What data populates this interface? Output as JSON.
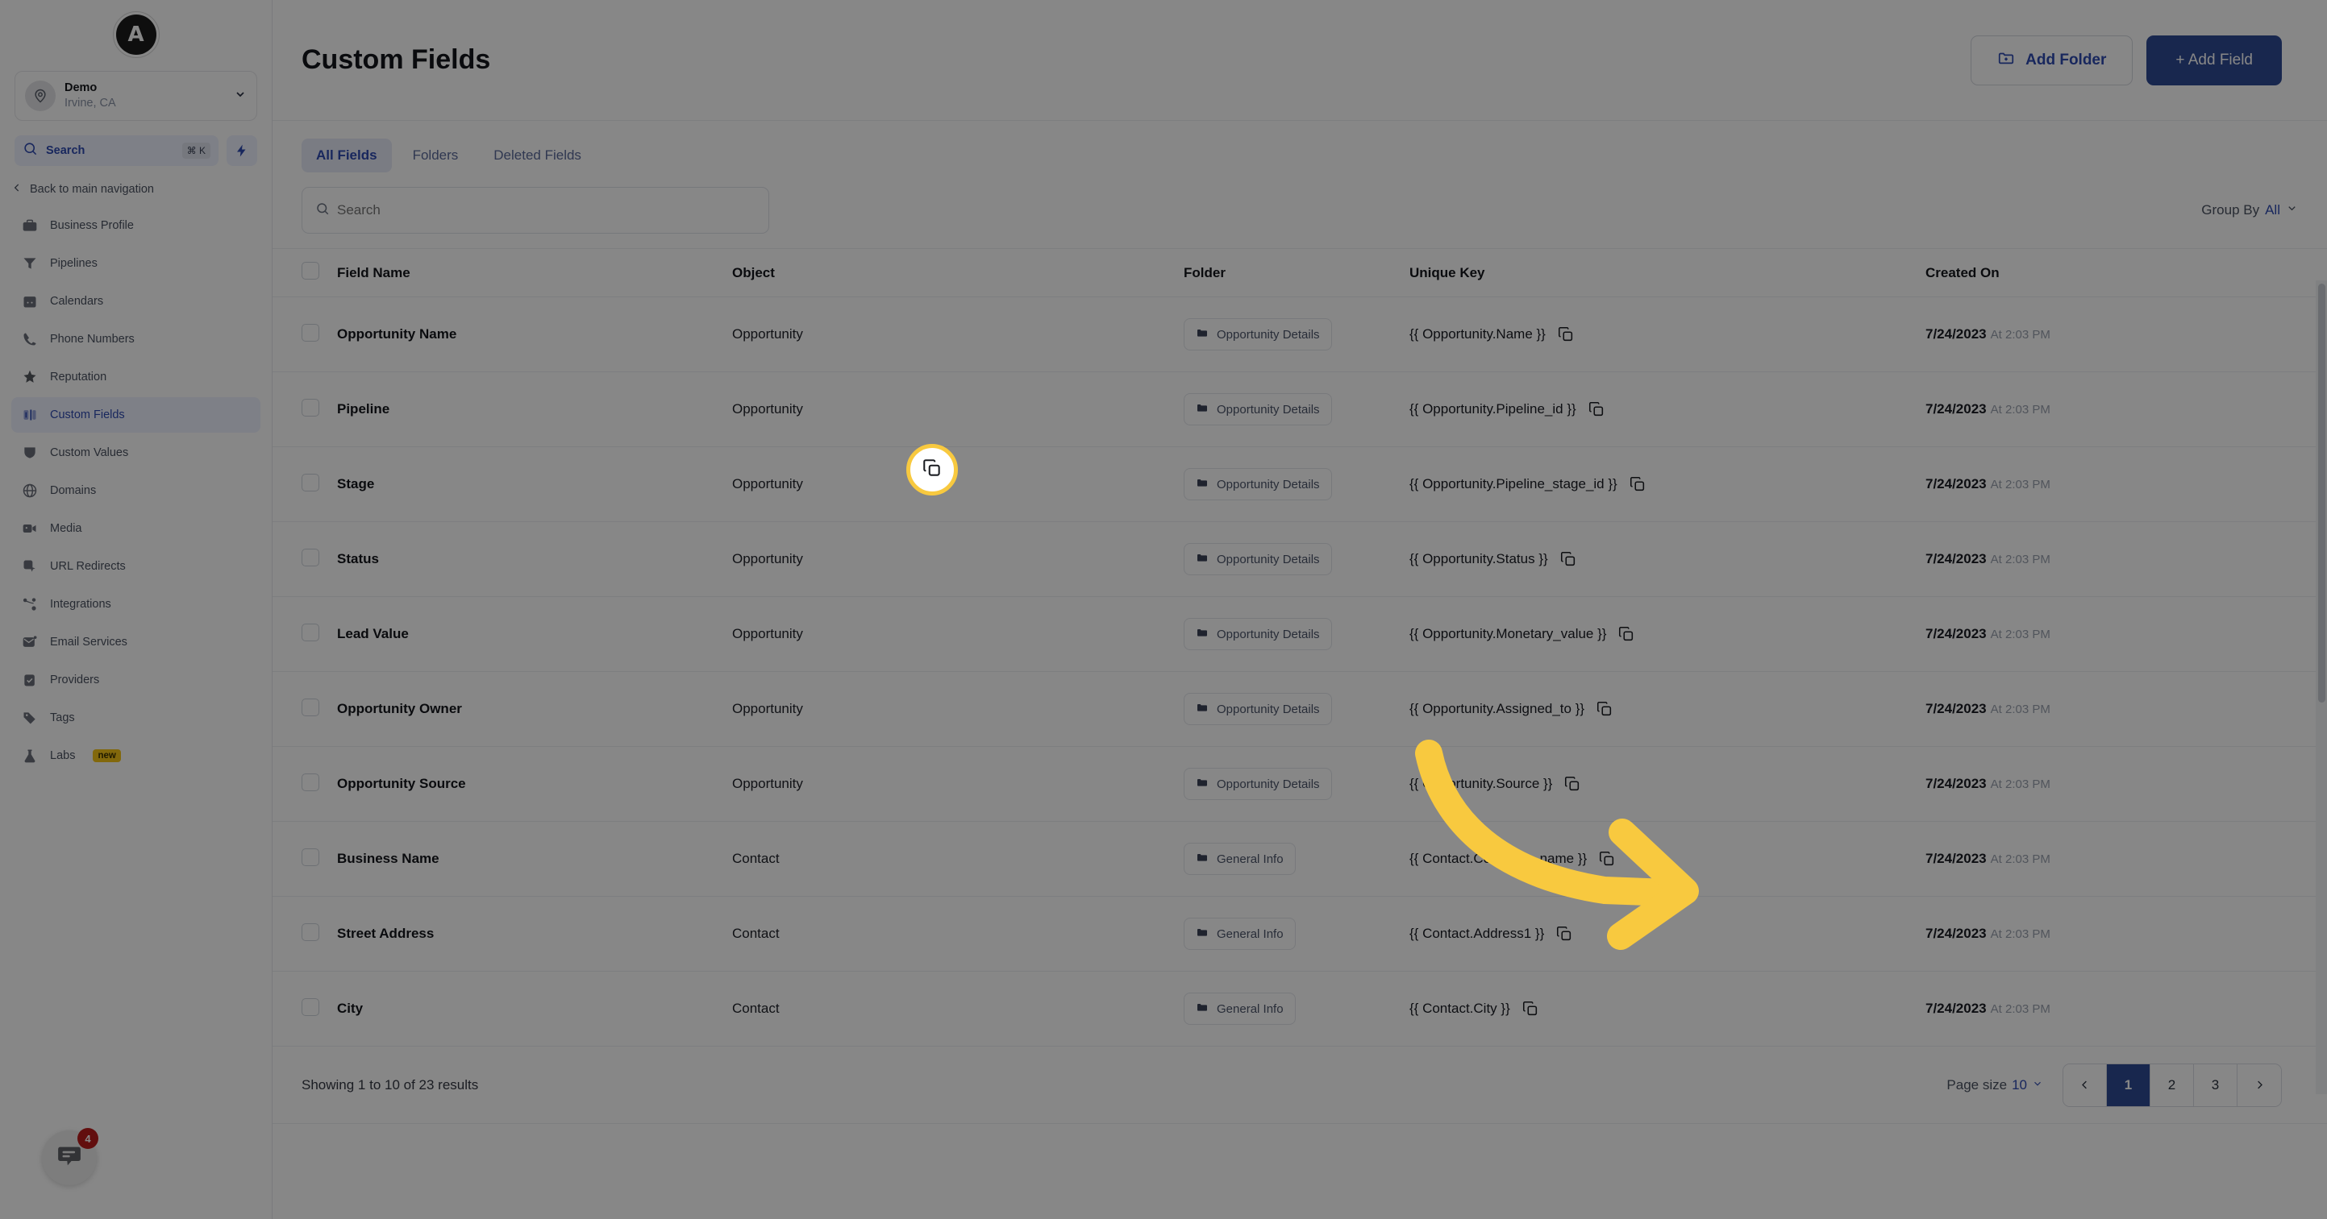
{
  "sidebar": {
    "logo_letter": "A",
    "location": {
      "name": "Demo",
      "sublabel": "Irvine, CA",
      "avatar_icon": "map-pin-icon",
      "chevron_icon": "chevron-down-icon"
    },
    "search": {
      "label": "Search",
      "shortcut": "⌘ K",
      "icon": "search-icon"
    },
    "quick_action_icon": "lightning-bolt-icon",
    "back_nav": {
      "label": "Back to main navigation",
      "icon": "chevron-left-icon"
    },
    "items": [
      {
        "label": "Business Profile",
        "icon": "briefcase-icon",
        "active": false,
        "badge": ""
      },
      {
        "label": "Pipelines",
        "icon": "funnel-icon",
        "active": false,
        "badge": ""
      },
      {
        "label": "Calendars",
        "icon": "calendar-icon",
        "active": false,
        "badge": ""
      },
      {
        "label": "Phone Numbers",
        "icon": "phone-icon",
        "active": false,
        "badge": ""
      },
      {
        "label": "Reputation",
        "icon": "star-sparkle-icon",
        "active": false,
        "badge": ""
      },
      {
        "label": "Custom Fields",
        "icon": "custom-fields-icon",
        "active": true,
        "badge": ""
      },
      {
        "label": "Custom Values",
        "icon": "shield-icon",
        "active": false,
        "badge": ""
      },
      {
        "label": "Domains",
        "icon": "globe-icon",
        "active": false,
        "badge": ""
      },
      {
        "label": "Media",
        "icon": "video-camera-icon",
        "active": false,
        "badge": ""
      },
      {
        "label": "URL Redirects",
        "icon": "cursor-click-icon",
        "active": false,
        "badge": ""
      },
      {
        "label": "Integrations",
        "icon": "nodes-icon",
        "active": false,
        "badge": ""
      },
      {
        "label": "Email Services",
        "icon": "envelope-icon",
        "active": false,
        "badge": ""
      },
      {
        "label": "Providers",
        "icon": "clipboard-check-icon",
        "active": false,
        "badge": ""
      },
      {
        "label": "Tags",
        "icon": "tag-icon",
        "active": false,
        "badge": ""
      },
      {
        "label": "Labs",
        "icon": "flask-icon",
        "active": false,
        "badge": "new"
      }
    ],
    "chat_widget": {
      "icon": "chat-bubble-icon",
      "unread_count": "4"
    }
  },
  "header": {
    "title": "Custom Fields",
    "add_folder_label": "Add Folder",
    "add_folder_icon": "folder-plus-icon",
    "add_field_label": "+ Add Field"
  },
  "tabs": [
    {
      "label": "All Fields",
      "active": true
    },
    {
      "label": "Folders",
      "active": false
    },
    {
      "label": "Deleted Fields",
      "active": false
    }
  ],
  "toolbar": {
    "search_placeholder": "Search",
    "search_value": "",
    "search_icon": "search-icon",
    "group_by_label": "Group By",
    "group_by_value": "All",
    "group_by_icon": "chevron-down-icon"
  },
  "table": {
    "columns": [
      "Field Name",
      "Object",
      "Folder",
      "Unique Key",
      "Created On"
    ],
    "copy_icon": "copy-icon",
    "folder_icon": "folder-icon",
    "rows": [
      {
        "checked": false,
        "field_name": "Opportunity Name",
        "object": "Opportunity",
        "folder": "Opportunity Details",
        "unique_key": "{{ Opportunity.Name }}",
        "created_date": "7/24/2023",
        "created_time": "At 2:03 PM"
      },
      {
        "checked": false,
        "field_name": "Pipeline",
        "object": "Opportunity",
        "folder": "Opportunity Details",
        "unique_key": "{{ Opportunity.Pipeline_id }}",
        "created_date": "7/24/2023",
        "created_time": "At 2:03 PM"
      },
      {
        "checked": false,
        "field_name": "Stage",
        "object": "Opportunity",
        "folder": "Opportunity Details",
        "unique_key": "{{ Opportunity.Pipeline_stage_id }}",
        "created_date": "7/24/2023",
        "created_time": "At 2:03 PM"
      },
      {
        "checked": false,
        "field_name": "Status",
        "object": "Opportunity",
        "folder": "Opportunity Details",
        "unique_key": "{{ Opportunity.Status }}",
        "created_date": "7/24/2023",
        "created_time": "At 2:03 PM"
      },
      {
        "checked": false,
        "field_name": "Lead Value",
        "object": "Opportunity",
        "folder": "Opportunity Details",
        "unique_key": "{{ Opportunity.Monetary_value }}",
        "created_date": "7/24/2023",
        "created_time": "At 2:03 PM"
      },
      {
        "checked": false,
        "field_name": "Opportunity Owner",
        "object": "Opportunity",
        "folder": "Opportunity Details",
        "unique_key": "{{ Opportunity.Assigned_to }}",
        "created_date": "7/24/2023",
        "created_time": "At 2:03 PM"
      },
      {
        "checked": false,
        "field_name": "Opportunity Source",
        "object": "Opportunity",
        "folder": "Opportunity Details",
        "unique_key": "{{ Opportunity.Source }}",
        "created_date": "7/24/2023",
        "created_time": "At 2:03 PM"
      },
      {
        "checked": false,
        "field_name": "Business Name",
        "object": "Contact",
        "folder": "General Info",
        "unique_key": "{{ Contact.Company_name }}",
        "created_date": "7/24/2023",
        "created_time": "At 2:03 PM"
      },
      {
        "checked": false,
        "field_name": "Street Address",
        "object": "Contact",
        "folder": "General Info",
        "unique_key": "{{ Contact.Address1 }}",
        "created_date": "7/24/2023",
        "created_time": "At 2:03 PM"
      },
      {
        "checked": false,
        "field_name": "City",
        "object": "Contact",
        "folder": "General Info",
        "unique_key": "{{ Contact.City }}",
        "created_date": "7/24/2023",
        "created_time": "At 2:03 PM"
      }
    ]
  },
  "footer": {
    "showing_text": "Showing 1 to 10 of 23 results",
    "page_size_label": "Page size",
    "page_size_value": "10",
    "prev_icon": "chevron-left-icon",
    "next_icon": "chevron-right-icon",
    "pages": [
      "1",
      "2",
      "3"
    ],
    "current_page": "1"
  },
  "annotation": {
    "arrow_color": "#f8c93f",
    "highlight_icon": "copy-icon",
    "target_row_field": "Business Name"
  }
}
